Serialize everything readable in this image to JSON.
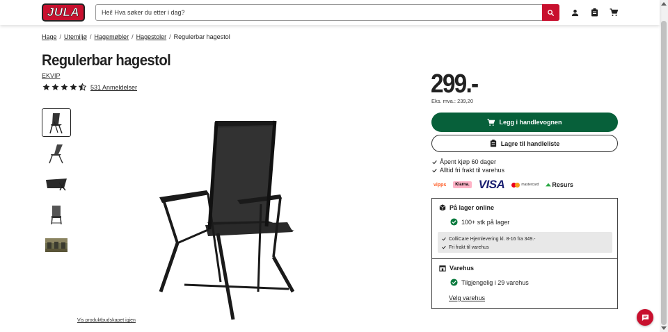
{
  "header": {
    "logo_text": "JULA",
    "search_placeholder": "Hei! Hva søker du etter i dag?",
    "icons": [
      "search-icon",
      "account-icon",
      "shopping-list-icon",
      "cart-icon"
    ]
  },
  "breadcrumb": [
    "Hage",
    "Utemiljø",
    "Hagemøbler",
    "Hagestoler",
    "Regulerbar hagestol"
  ],
  "product": {
    "title": "Regulerbar hagestol",
    "brand": "EKVIP",
    "rating": 4.5,
    "reviews": "531 Anmeldelser",
    "show_package": "Vis produktbudskapet igjen",
    "price": "299.-",
    "price_ex_vat": "Eks. mva.: 239,20",
    "add_to_cart": "Legg i handlevognen",
    "save_to_list": "Lagre til handleliste",
    "usps": [
      "Åpent kjøp 60 dager",
      "Alltid fri frakt til varehus"
    ],
    "payment_methods": [
      "vipps",
      "Klarna.",
      "VISA",
      "mastercard",
      "Resurs"
    ]
  },
  "stock": {
    "online_title": "På lager online",
    "online_status": "100+ stk på lager",
    "delivery_notes": [
      "ColliCare Hjemlevering kl. 8-16 fra 349.-",
      "Fri frakt til varehus"
    ],
    "store_title": "Varehus",
    "store_status": "Tilgjengelig i 29 varehus",
    "choose_store": "Velg varehus"
  },
  "colors": {
    "brand_red": "#c8102e",
    "cart_green": "#07603a",
    "status_green": "#0b7a3e"
  }
}
